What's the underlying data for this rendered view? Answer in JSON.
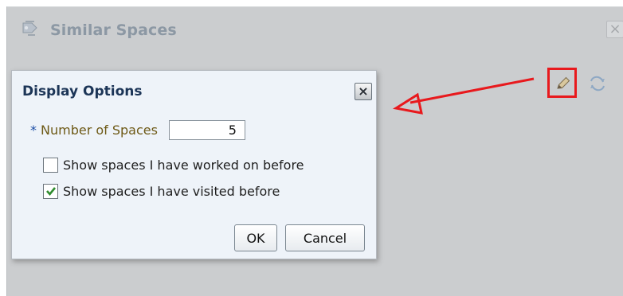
{
  "panel": {
    "title": "Similar Spaces",
    "close_icon": "close-icon",
    "icon": "similar-spaces-icon"
  },
  "toolbar": {
    "edit_icon": "pencil-icon",
    "refresh_icon": "refresh-icon",
    "highlight_color": "#e8191d"
  },
  "dialog": {
    "title": "Display Options",
    "close_icon": "close-icon",
    "number_field": {
      "required_mark": "*",
      "label": "Number of Spaces",
      "value": "5"
    },
    "options": [
      {
        "label": "Show spaces I have worked on before",
        "checked": false
      },
      {
        "label": "Show spaces I have visited before",
        "checked": true
      }
    ],
    "ok_label": "OK",
    "cancel_label": "Cancel"
  }
}
